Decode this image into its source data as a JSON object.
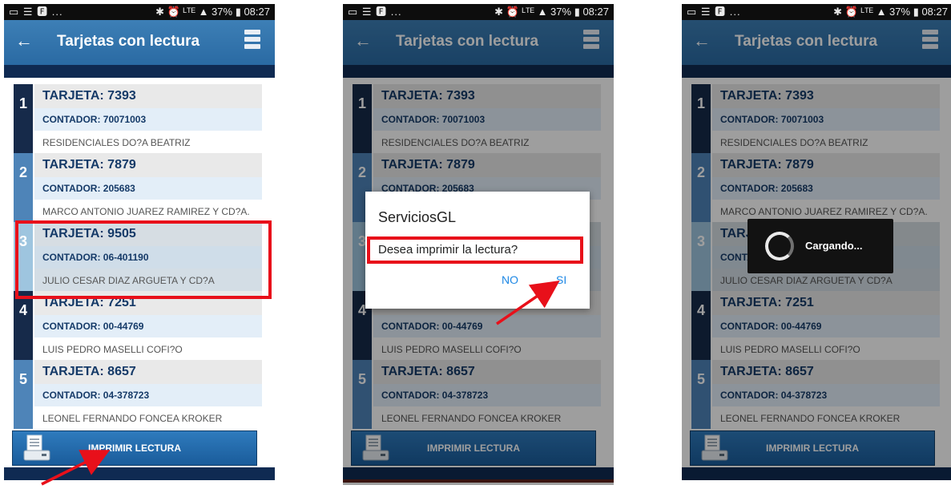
{
  "status": {
    "left_icons": "▭ ☰ 🅵 ...",
    "right": "✱ ⏰ ᴸᵀᴱ ▲ 37% ▮ 08:27"
  },
  "appbar": {
    "title": "Tarjetas con lectura",
    "back_icon": "←"
  },
  "cards": [
    {
      "num": "1",
      "title": "TARJETA: 7393",
      "meter": "CONTADOR: 70071003",
      "name": "RESIDENCIALES DO?A BEATRIZ"
    },
    {
      "num": "2",
      "title": "TARJETA: 7879",
      "meter": "CONTADOR: 205683",
      "name": "MARCO ANTONIO JUAREZ RAMIREZ Y CD?A."
    },
    {
      "num": "3",
      "title": "TARJETA: 9505",
      "meter": "CONTADOR: 06-401190",
      "name": "JULIO CESAR DIAZ ARGUETA Y CD?A"
    },
    {
      "num": "4",
      "title": "TARJETA: 7251",
      "meter": "CONTADOR: 00-44769",
      "name": "LUIS PEDRO MASELLI COFI?O"
    },
    {
      "num": "5",
      "title": "TARJETA: 8657",
      "meter": "CONTADOR: 04-378723",
      "name": "LEONEL FERNANDO FONCEA KROKER"
    }
  ],
  "print_button": "IMPRIMIR LECTURA",
  "dialog": {
    "title": "ServiciosGL",
    "message": "Desea imprimir la lectura?",
    "no": "NO",
    "si": "SI"
  },
  "loading": {
    "text": "Cargando..."
  },
  "colors": {
    "highlight": "#e8101a",
    "appbar": "#2f72ac",
    "dialog_button": "#1e88e5"
  }
}
